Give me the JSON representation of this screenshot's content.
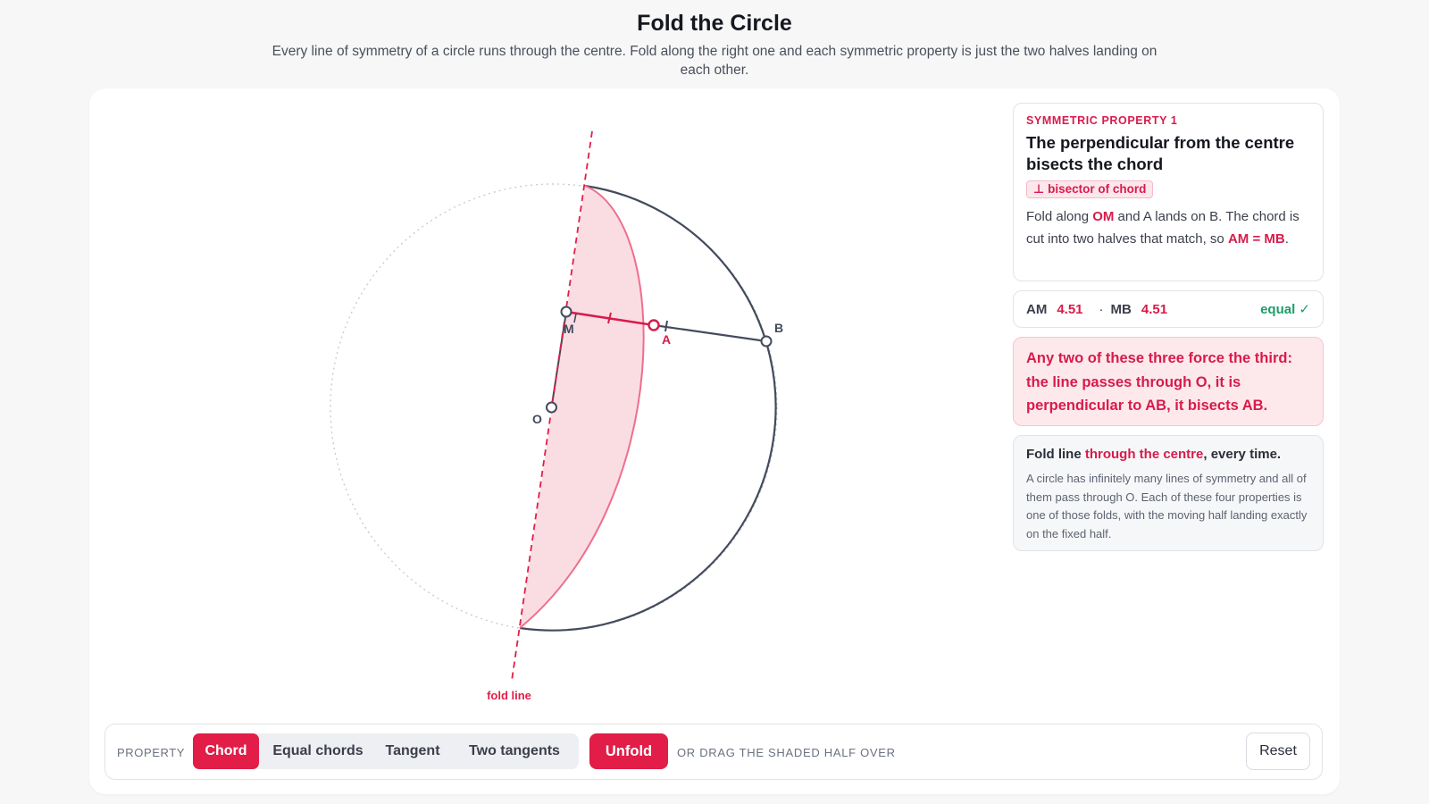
{
  "header": {
    "title": "Fold the Circle",
    "subtitle": "Every line of symmetry of a circle runs through the centre. Fold along the right one and each symmetric property is just the two halves landing on each other."
  },
  "diagram": {
    "points": {
      "o": "O",
      "m": "M",
      "a": "A",
      "b": "B"
    },
    "fold_label": "fold line"
  },
  "property_card": {
    "eyebrow": "SYMMETRIC PROPERTY 1",
    "title": "The perpendicular from the centre bisects the chord",
    "tag": "⊥ bisector of chord",
    "body": {
      "t1": "Fold along ",
      "h1": "OM",
      "t2": " and A lands on B. The chord is cut into two halves that match, so ",
      "h2": "AM = MB",
      "t3": "."
    }
  },
  "measure": {
    "am_label": "AM",
    "am_value": "4.51",
    "sep": "·",
    "mb_label": "MB",
    "mb_value": "4.51",
    "status": "equal ✓"
  },
  "callout": {
    "text": "Any two of these three force the third: the line passes through O, it is perpendicular to AB, it bisects AB."
  },
  "note": {
    "lead_t1": "Fold line ",
    "lead_h": "through the centre",
    "lead_t2": ", every time.",
    "body": "A circle has infinitely many lines of symmetry and all of them pass through O. Each of these four properties is one of those folds, with the moving half landing exactly on the fixed half."
  },
  "toolbar": {
    "property_label": "PROPERTY",
    "tabs": [
      "Chord",
      "Equal chords",
      "Tangent",
      "Two tangents"
    ],
    "active_tab": "Chord",
    "unfold_label": "Unfold",
    "hint": "OR DRAG THE SHADED HALF OVER",
    "reset_label": "Reset"
  },
  "colors": {
    "accent": "#e11d48",
    "accent_text": "#d81b4b",
    "ink": "#434b5c",
    "shade": "#f9dde3",
    "success": "#1f9d6a"
  }
}
